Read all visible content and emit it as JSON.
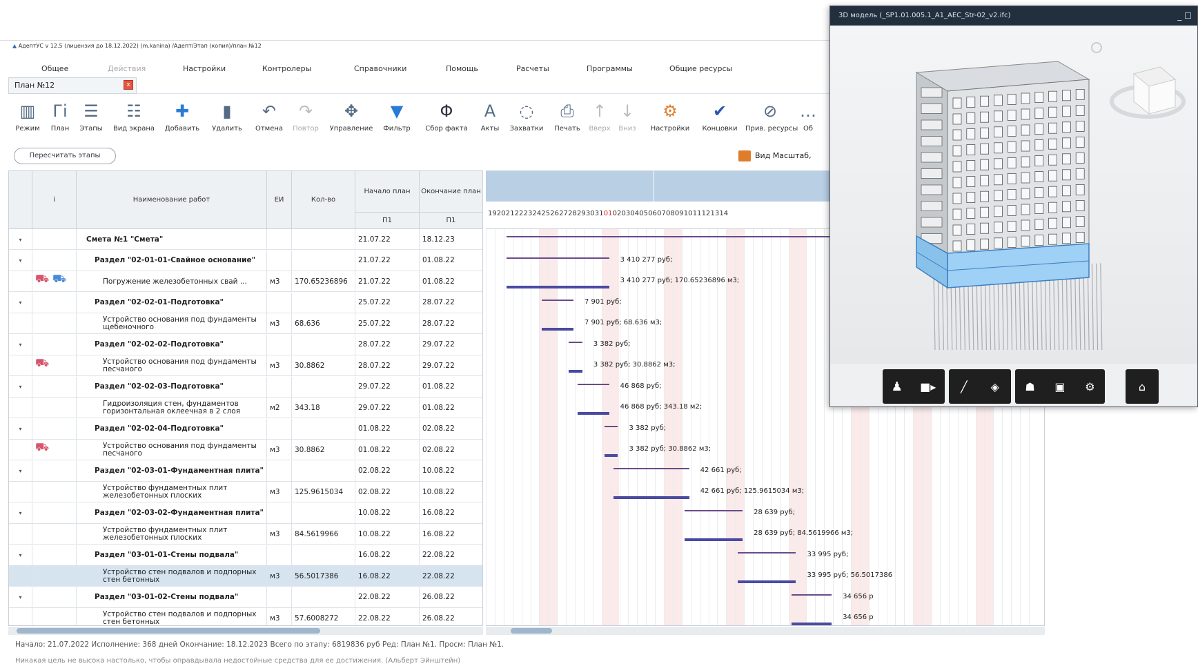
{
  "app": {
    "title": "АдептУС v 12.5 (лицензия до 18.12.2022) (m.kanina) /Адепт/Этап (копия)/план №12"
  },
  "menu": [
    "Общее",
    "Действия",
    "Настройки",
    "Контролеры",
    "Справочники",
    "Помощь",
    "Расчеты",
    "Программы",
    "Общие ресурсы"
  ],
  "tab": {
    "label": "План №12",
    "close": "x"
  },
  "toolbar": [
    {
      "label": "Режим",
      "icon": "mode-icon"
    },
    {
      "label": "План",
      "icon": "plan-icon"
    },
    {
      "label": "Этапы",
      "icon": "stages-icon"
    },
    {
      "label": "Вид экрана",
      "icon": "screen-view-icon"
    },
    {
      "label": "Добавить",
      "icon": "add-icon"
    },
    {
      "label": "Удалить",
      "icon": "trash-icon"
    },
    {
      "label": "Отмена",
      "icon": "undo-icon"
    },
    {
      "label": "Повтор",
      "icon": "redo-icon"
    },
    {
      "label": "Управление",
      "icon": "move-icon"
    },
    {
      "label": "Фильтр",
      "icon": "filter-icon"
    },
    {
      "label": "Сбор факта",
      "icon": "fact-icon"
    },
    {
      "label": "Акты",
      "icon": "acts-icon"
    },
    {
      "label": "Захватки",
      "icon": "grips-icon"
    },
    {
      "label": "Печать",
      "icon": "print-icon"
    },
    {
      "label": "Вверх",
      "icon": "arrow-up-icon"
    },
    {
      "label": "Вниз",
      "icon": "arrow-down-icon"
    },
    {
      "label": "Настройки",
      "icon": "settings-icon"
    },
    {
      "label": "Концовки",
      "icon": "endings-icon"
    },
    {
      "label": "Прив. ресурсы",
      "icon": "resources-icon"
    },
    {
      "label": "Об",
      "icon": "more-icon"
    }
  ],
  "recalc_button": "Пересчитать этапы",
  "view_button": "Вид Масштаб,",
  "table": {
    "headers": {
      "info": "i",
      "name": "Наименование работ",
      "unit": "ЕИ",
      "qty": "Кол-во",
      "start": "Начало план",
      "end": "Окончание план",
      "start_sub": "П1",
      "end_sub": "П1"
    },
    "rows": [
      {
        "exp": "▾",
        "name": "Смета №1 \"Смета\"",
        "unit": "",
        "qty": "",
        "start": "21.07.22",
        "end": "18.12.23",
        "bold": true
      },
      {
        "exp": "▾",
        "name": "Раздел \"02-01-01-Свайное основание\"",
        "unit": "",
        "qty": "",
        "start": "21.07.22",
        "end": "01.08.22",
        "bold": true
      },
      {
        "exp": "",
        "name": "Погружение железобетонных свай ...",
        "unit": "м3",
        "qty": "170.65236896",
        "start": "21.07.22",
        "end": "01.08.22",
        "bold": false
      },
      {
        "exp": "▾",
        "name": "Раздел \"02-02-01-Подготовка\"",
        "unit": "",
        "qty": "",
        "start": "25.07.22",
        "end": "28.07.22",
        "bold": true
      },
      {
        "exp": "",
        "name": "Устройство основания под фундаменты щебеночного",
        "unit": "м3",
        "qty": "68.636",
        "start": "25.07.22",
        "end": "28.07.22",
        "bold": false
      },
      {
        "exp": "▾",
        "name": "Раздел \"02-02-02-Подготовка\"",
        "unit": "",
        "qty": "",
        "start": "28.07.22",
        "end": "29.07.22",
        "bold": true
      },
      {
        "exp": "",
        "name": "Устройство основания под фундаменты песчаного",
        "unit": "м3",
        "qty": "30.8862",
        "start": "28.07.22",
        "end": "29.07.22",
        "bold": false
      },
      {
        "exp": "▾",
        "name": "Раздел \"02-02-03-Подготовка\"",
        "unit": "",
        "qty": "",
        "start": "29.07.22",
        "end": "01.08.22",
        "bold": true
      },
      {
        "exp": "",
        "name": "Гидроизоляция стен, фундаментов горизонтальная оклеечная в 2 слоя",
        "unit": "м2",
        "qty": "343.18",
        "start": "29.07.22",
        "end": "01.08.22",
        "bold": false
      },
      {
        "exp": "▾",
        "name": "Раздел \"02-02-04-Подготовка\"",
        "unit": "",
        "qty": "",
        "start": "01.08.22",
        "end": "02.08.22",
        "bold": true
      },
      {
        "exp": "",
        "name": "Устройство основания под фундаменты песчаного",
        "unit": "м3",
        "qty": "30.8862",
        "start": "01.08.22",
        "end": "02.08.22",
        "bold": false
      },
      {
        "exp": "▾",
        "name": "Раздел \"02-03-01-Фундаментная плита\"",
        "unit": "",
        "qty": "",
        "start": "02.08.22",
        "end": "10.08.22",
        "bold": true
      },
      {
        "exp": "",
        "name": "Устройство фундаментных плит железобетонных плоских",
        "unit": "м3",
        "qty": "125.9615034",
        "start": "02.08.22",
        "end": "10.08.22",
        "bold": false
      },
      {
        "exp": "▾",
        "name": "Раздел \"02-03-02-Фундаментная плита\"",
        "unit": "",
        "qty": "",
        "start": "10.08.22",
        "end": "16.08.22",
        "bold": true
      },
      {
        "exp": "",
        "name": "Устройство фундаментных плит железобетонных плоских",
        "unit": "м3",
        "qty": "84.5619966",
        "start": "10.08.22",
        "end": "16.08.22",
        "bold": false
      },
      {
        "exp": "▾",
        "name": "Раздел \"03-01-01-Стены подвала\"",
        "unit": "",
        "qty": "",
        "start": "16.08.22",
        "end": "22.08.22",
        "bold": true
      },
      {
        "exp": "",
        "name": "Устройство стен подвалов и подпорных стен бетонных",
        "unit": "м3",
        "qty": "56.5017386",
        "start": "16.08.22",
        "end": "22.08.22",
        "bold": false,
        "selected": true
      },
      {
        "exp": "▾",
        "name": "Раздел \"03-01-02-Стены подвала\"",
        "unit": "",
        "qty": "",
        "start": "22.08.22",
        "end": "26.08.22",
        "bold": true
      },
      {
        "exp": "",
        "name": "Устройство стен подвалов и подпорных стен бетонных",
        "unit": "м3",
        "qty": "57.6008272",
        "start": "22.08.22",
        "end": "26.08.22",
        "bold": false
      }
    ]
  },
  "gantt": {
    "days": [
      "19",
      "20",
      "21",
      "22",
      "23",
      "24",
      "25",
      "26",
      "27",
      "28",
      "29",
      "30",
      "31",
      "01",
      "02",
      "03",
      "04",
      "05",
      "06",
      "07",
      "08",
      "09",
      "10",
      "11",
      "12",
      "13",
      "14"
    ],
    "red_day": "01",
    "labels": [
      "",
      "3 410 277 руб;",
      "3 410 277 руб; 170.65236896 м3;",
      "7 901 руб;",
      "7 901 руб; 68.636 м3;",
      "3 382 руб;",
      "3 382 руб; 30.8862 м3;",
      "46 868 руб;",
      "46 868 руб; 343.18 м2;",
      "3 382 руб;",
      "3 382 руб; 30.8862 м3;",
      "42 661 руб;",
      "42 661 руб; 125.9615034 м3;",
      "28 639 руб;",
      "28 639 руб; 84.5619966 м3;",
      "33 995 руб;",
      "33 995 руб; 56.5017386",
      "34 656 р",
      "34 656 р"
    ]
  },
  "status": "Начало: 21.07.2022  Исполнение: 368 дней  Окончание: 18.12.2023  Всего по этапу: 6819836 руб  Ред: План №1.  Просм: План №1.",
  "quote": "Никакая цель не высока настолько, чтобы оправдывала недостойные средства для ее достижения. (Альберт Эйнштейн)",
  "model3d": {
    "title": "3D модель (_SP1.01.005.1_A1_AEC_Str-02_v2.ifc)",
    "controls": "_ ☐",
    "toolbar_icons": [
      "person-icon",
      "camera-icon",
      "ruler-icon",
      "cube-icon",
      "hierarchy-icon",
      "properties-icon",
      "settings-icon",
      "home-icon"
    ]
  }
}
